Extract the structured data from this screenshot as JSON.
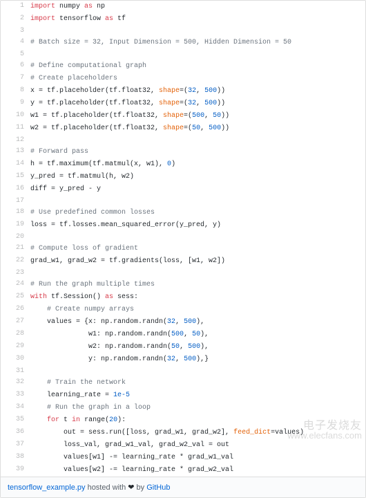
{
  "lines": [
    {
      "n": 1,
      "seg": [
        [
          "kw",
          "import"
        ],
        [
          "",
          " numpy "
        ],
        [
          "kw",
          "as"
        ],
        [
          "",
          " np"
        ]
      ]
    },
    {
      "n": 2,
      "seg": [
        [
          "kw",
          "import"
        ],
        [
          "",
          " tensorflow "
        ],
        [
          "kw",
          "as"
        ],
        [
          "",
          " tf"
        ]
      ]
    },
    {
      "n": 3,
      "seg": [
        [
          "",
          ""
        ]
      ]
    },
    {
      "n": 4,
      "seg": [
        [
          "cm",
          "# Batch size = 32, Input Dimension = 500, Hidden Dimension = 50"
        ]
      ]
    },
    {
      "n": 5,
      "seg": [
        [
          "",
          ""
        ]
      ]
    },
    {
      "n": 6,
      "seg": [
        [
          "cm",
          "# Define computational graph"
        ]
      ]
    },
    {
      "n": 7,
      "seg": [
        [
          "cm",
          "# Create placeholders"
        ]
      ]
    },
    {
      "n": 8,
      "seg": [
        [
          "",
          "x = tf.placeholder(tf.float32, "
        ],
        [
          "str",
          "shape"
        ],
        [
          "",
          "=("
        ],
        [
          "num",
          "32"
        ],
        [
          "",
          ", "
        ],
        [
          "num",
          "500"
        ],
        [
          "",
          "))"
        ]
      ]
    },
    {
      "n": 9,
      "seg": [
        [
          "",
          "y = tf.placeholder(tf.float32, "
        ],
        [
          "str",
          "shape"
        ],
        [
          "",
          "=("
        ],
        [
          "num",
          "32"
        ],
        [
          "",
          ", "
        ],
        [
          "num",
          "500"
        ],
        [
          "",
          "))"
        ]
      ]
    },
    {
      "n": 10,
      "seg": [
        [
          "",
          "w1 = tf.placeholder(tf.float32, "
        ],
        [
          "str",
          "shape"
        ],
        [
          "",
          "=("
        ],
        [
          "num",
          "500"
        ],
        [
          "",
          ", "
        ],
        [
          "num",
          "50"
        ],
        [
          "",
          "))"
        ]
      ]
    },
    {
      "n": 11,
      "seg": [
        [
          "",
          "w2 = tf.placeholder(tf.float32, "
        ],
        [
          "str",
          "shape"
        ],
        [
          "",
          "=("
        ],
        [
          "num",
          "50"
        ],
        [
          "",
          ", "
        ],
        [
          "num",
          "500"
        ],
        [
          "",
          "))"
        ]
      ]
    },
    {
      "n": 12,
      "seg": [
        [
          "",
          ""
        ]
      ]
    },
    {
      "n": 13,
      "seg": [
        [
          "cm",
          "# Forward pass"
        ]
      ]
    },
    {
      "n": 14,
      "seg": [
        [
          "",
          "h = tf.maximum(tf.matmul(x, w1), "
        ],
        [
          "num",
          "0"
        ],
        [
          "",
          ")"
        ]
      ]
    },
    {
      "n": 15,
      "seg": [
        [
          "",
          "y_pred = tf.matmul(h, w2)"
        ]
      ]
    },
    {
      "n": 16,
      "seg": [
        [
          "",
          "diff = y_pred - y"
        ]
      ]
    },
    {
      "n": 17,
      "seg": [
        [
          "",
          ""
        ]
      ]
    },
    {
      "n": 18,
      "seg": [
        [
          "cm",
          "# Use predefined common losses"
        ]
      ]
    },
    {
      "n": 19,
      "seg": [
        [
          "",
          "loss = tf.losses.mean_squared_error(y_pred, y)"
        ]
      ]
    },
    {
      "n": 20,
      "seg": [
        [
          "",
          ""
        ]
      ]
    },
    {
      "n": 21,
      "seg": [
        [
          "cm",
          "# Compute loss of gradient"
        ]
      ]
    },
    {
      "n": 22,
      "seg": [
        [
          "",
          "grad_w1, grad_w2 = tf.gradients(loss, [w1, w2])"
        ]
      ]
    },
    {
      "n": 23,
      "seg": [
        [
          "",
          ""
        ]
      ]
    },
    {
      "n": 24,
      "seg": [
        [
          "cm",
          "# Run the graph multiple times"
        ]
      ]
    },
    {
      "n": 25,
      "seg": [
        [
          "kw",
          "with"
        ],
        [
          "",
          " tf.Session() "
        ],
        [
          "kw",
          "as"
        ],
        [
          "",
          " sess:"
        ]
      ]
    },
    {
      "n": 26,
      "seg": [
        [
          "",
          "    "
        ],
        [
          "cm",
          "# Create numpy arrays"
        ]
      ]
    },
    {
      "n": 27,
      "seg": [
        [
          "",
          "    values = {x: np.random.randn("
        ],
        [
          "num",
          "32"
        ],
        [
          "",
          ", "
        ],
        [
          "num",
          "500"
        ],
        [
          "",
          "),"
        ]
      ]
    },
    {
      "n": 28,
      "seg": [
        [
          "",
          "              w1: np.random.randn("
        ],
        [
          "num",
          "500"
        ],
        [
          "",
          ", "
        ],
        [
          "num",
          "50"
        ],
        [
          "",
          "),"
        ]
      ]
    },
    {
      "n": 29,
      "seg": [
        [
          "",
          "              w2: np.random.randn("
        ],
        [
          "num",
          "50"
        ],
        [
          "",
          ", "
        ],
        [
          "num",
          "500"
        ],
        [
          "",
          "),"
        ]
      ]
    },
    {
      "n": 30,
      "seg": [
        [
          "",
          "              y: np.random.randn("
        ],
        [
          "num",
          "32"
        ],
        [
          "",
          ", "
        ],
        [
          "num",
          "500"
        ],
        [
          "",
          "),}"
        ]
      ]
    },
    {
      "n": 31,
      "seg": [
        [
          "",
          ""
        ]
      ]
    },
    {
      "n": 32,
      "seg": [
        [
          "",
          "    "
        ],
        [
          "cm",
          "# Train the network"
        ]
      ]
    },
    {
      "n": 33,
      "seg": [
        [
          "",
          "    learning_rate = "
        ],
        [
          "num",
          "1e-5"
        ]
      ]
    },
    {
      "n": 34,
      "seg": [
        [
          "",
          "    "
        ],
        [
          "cm",
          "# Run the graph in a loop"
        ]
      ]
    },
    {
      "n": 35,
      "seg": [
        [
          "",
          "    "
        ],
        [
          "kw",
          "for"
        ],
        [
          "",
          " t "
        ],
        [
          "kw",
          "in"
        ],
        [
          "",
          " range("
        ],
        [
          "num",
          "20"
        ],
        [
          "",
          "):"
        ]
      ]
    },
    {
      "n": 36,
      "seg": [
        [
          "",
          "        out = sess.run([loss, grad_w1, grad_w2], "
        ],
        [
          "str",
          "feed_dict"
        ],
        [
          "",
          "=values)"
        ]
      ]
    },
    {
      "n": 37,
      "seg": [
        [
          "",
          "        loss_val, grad_w1_val, grad_w2_val = out"
        ]
      ]
    },
    {
      "n": 38,
      "seg": [
        [
          "",
          "        values[w1] -= learning_rate * grad_w1_val"
        ]
      ]
    },
    {
      "n": 39,
      "seg": [
        [
          "",
          "        values[w2] -= learning_rate * grad_w2_val"
        ]
      ]
    }
  ],
  "meta": {
    "filename": "tensorflow_example.py",
    "hosted": " hosted with ",
    "heart": "❤",
    "by": " by ",
    "host": "GitHub"
  },
  "watermark": {
    "line1": "电子发烧友",
    "line2": "www.elecfans.com"
  }
}
